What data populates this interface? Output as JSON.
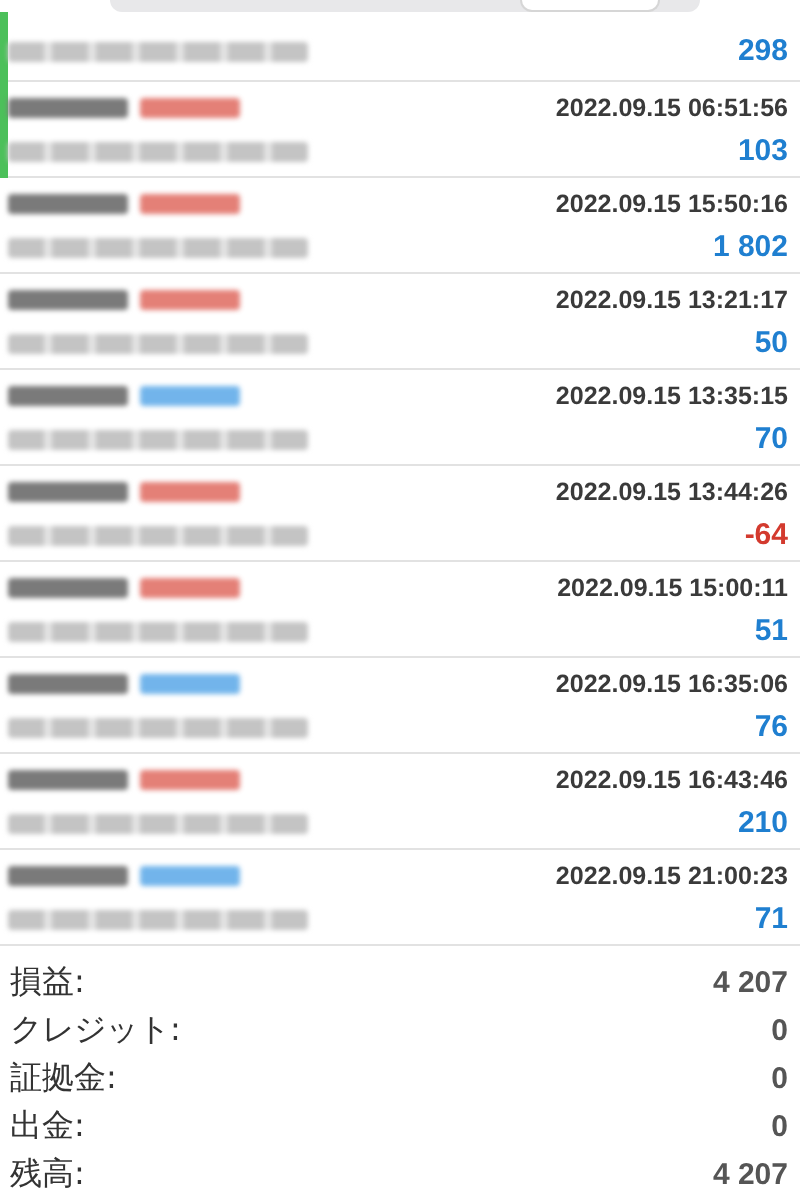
{
  "deals": [
    {
      "highlighted": true,
      "profit": "298",
      "loss": false
    },
    {
      "kind": "sell",
      "highlighted": true,
      "time": "2022.09.15 06:51:56",
      "profit": "103",
      "loss": false
    },
    {
      "kind": "sell",
      "highlighted": false,
      "time": "2022.09.15 15:50:16",
      "profit": "1 802",
      "loss": false
    },
    {
      "kind": "sell",
      "highlighted": false,
      "time": "2022.09.15 13:21:17",
      "profit": "50",
      "loss": false
    },
    {
      "kind": "buy",
      "highlighted": false,
      "time": "2022.09.15 13:35:15",
      "profit": "70",
      "loss": false
    },
    {
      "kind": "sell",
      "highlighted": false,
      "time": "2022.09.15 13:44:26",
      "profit": "-64",
      "loss": true
    },
    {
      "kind": "sell",
      "highlighted": false,
      "time": "2022.09.15 15:00:11",
      "profit": "51",
      "loss": false
    },
    {
      "kind": "buy",
      "highlighted": false,
      "time": "2022.09.15 16:35:06",
      "profit": "76",
      "loss": false
    },
    {
      "kind": "sell",
      "highlighted": false,
      "time": "2022.09.15 16:43:46",
      "profit": "210",
      "loss": false
    },
    {
      "kind": "buy",
      "highlighted": false,
      "time": "2022.09.15 21:00:23",
      "profit": "71",
      "loss": false
    }
  ],
  "summary": [
    {
      "label": "損益:",
      "value": "4 207"
    },
    {
      "label": "クレジット:",
      "value": "0"
    },
    {
      "label": "証拠金:",
      "value": "0"
    },
    {
      "label": "出金:",
      "value": "0"
    },
    {
      "label": "残高:",
      "value": "4 207"
    }
  ]
}
